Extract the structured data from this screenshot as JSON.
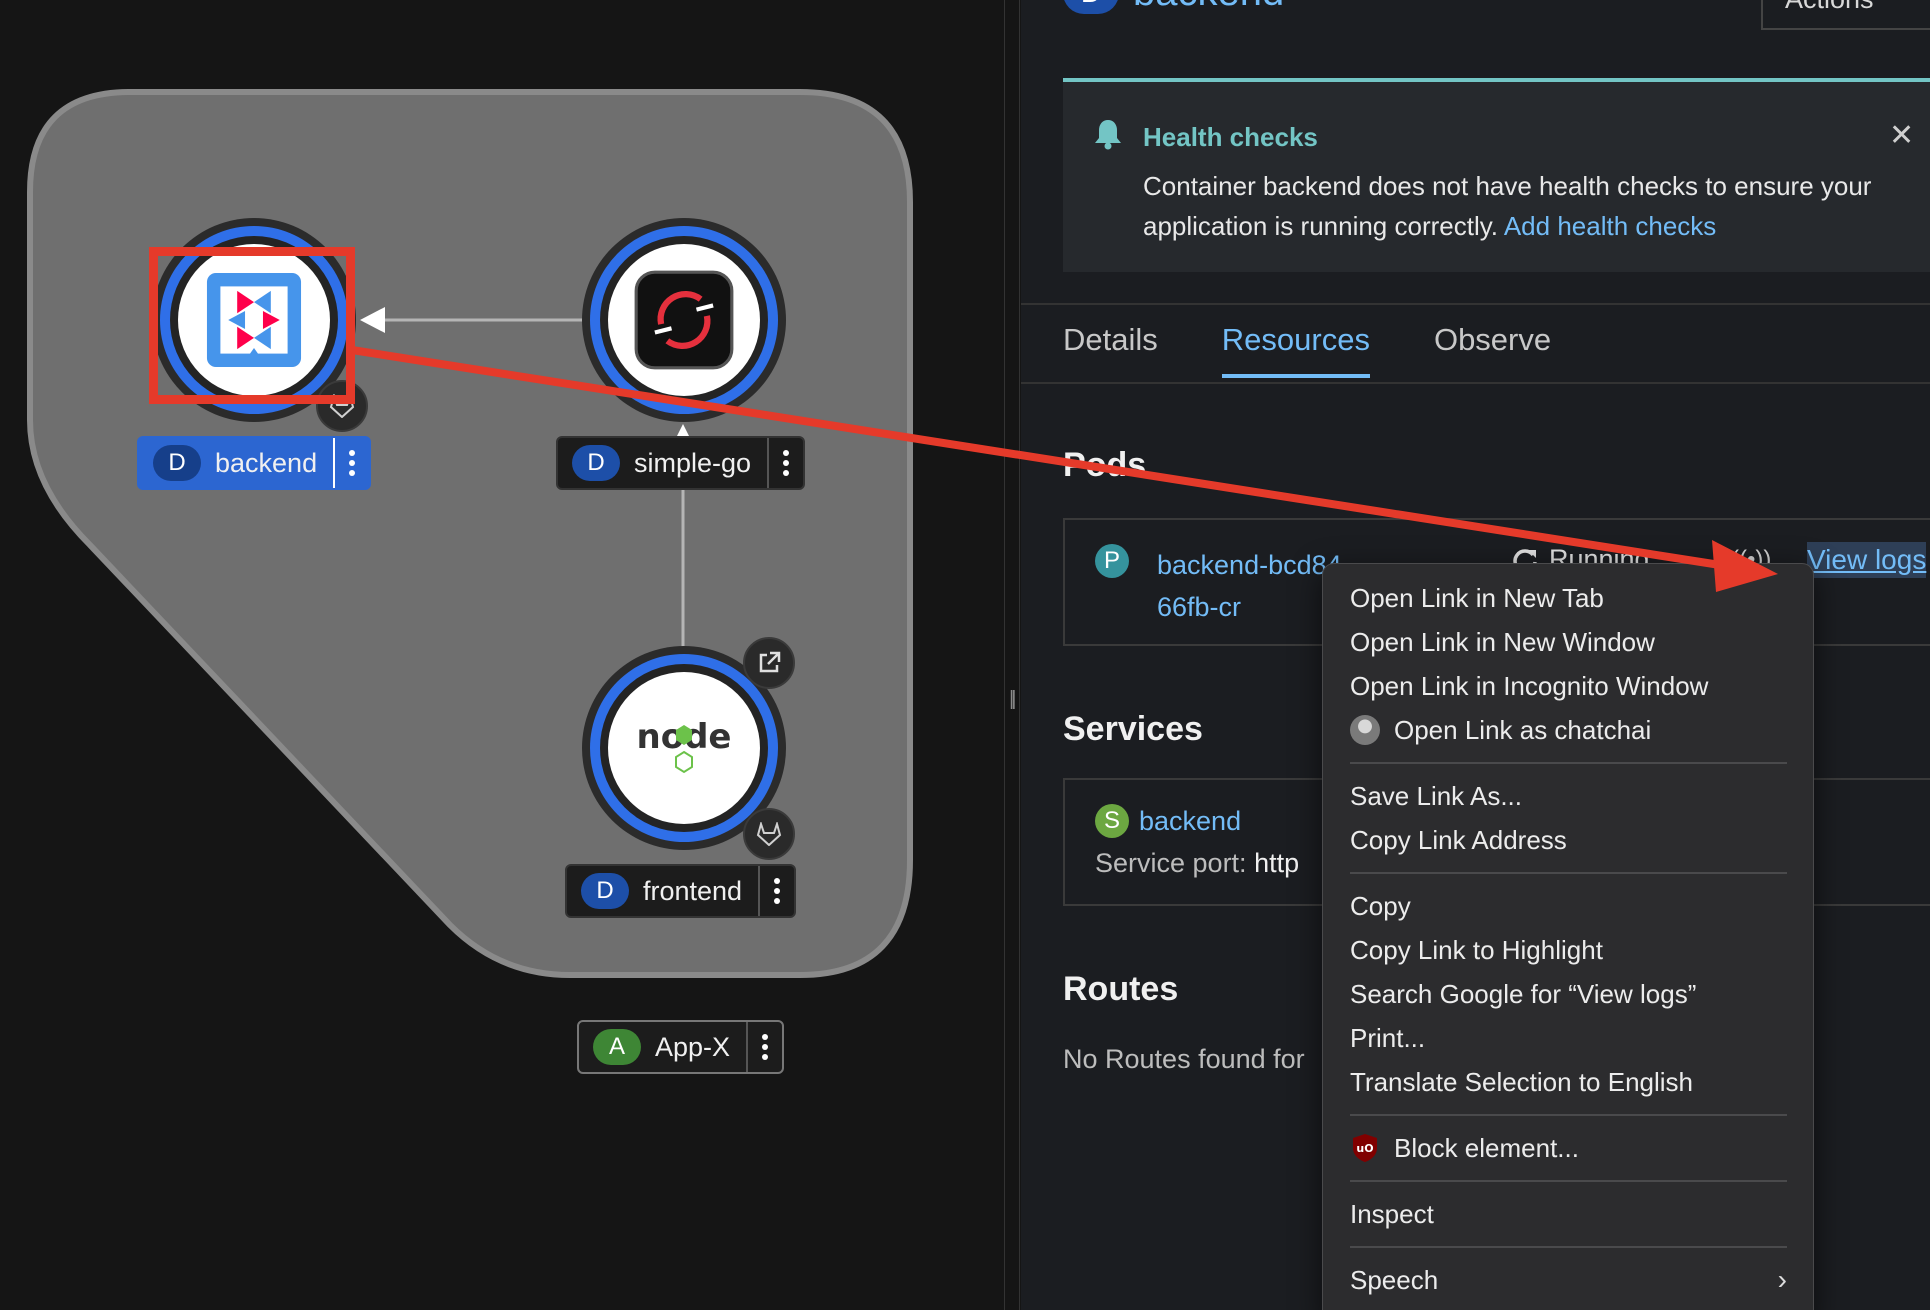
{
  "topology": {
    "nodes": [
      {
        "kind": "D",
        "name": "backend",
        "icon": "quarkus-icon",
        "selected": true
      },
      {
        "kind": "D",
        "name": "simple-go",
        "icon": "openshift-icon",
        "selected": false
      },
      {
        "kind": "D",
        "name": "frontend",
        "icon": "nodejs-icon",
        "selected": false
      }
    ],
    "application": {
      "kind": "A",
      "name": "App-X"
    },
    "nodejs_logo_text": "node"
  },
  "panel": {
    "resource_kind": "D",
    "resource_name": "backend",
    "actions_label": "Actions",
    "alert": {
      "title": "Health checks",
      "body": "Container backend does not have health checks to ensure your application is running correctly.",
      "link": "Add health checks"
    },
    "tabs": [
      {
        "label": "Details",
        "active": false
      },
      {
        "label": "Resources",
        "active": true
      },
      {
        "label": "Observe",
        "active": false
      }
    ],
    "pods": {
      "title": "Pods",
      "badge": "P",
      "name": "backend-bcd8466fb-cr",
      "status": "Running",
      "link": "View logs"
    },
    "services": {
      "title": "Services",
      "badge": "S",
      "name": "backend",
      "port_label": "Service port:",
      "port_value": "http"
    },
    "routes": {
      "title": "Routes",
      "empty": "No Routes found for"
    }
  },
  "context_menu": {
    "groups": [
      [
        "Open Link in New Tab",
        "Open Link in New Window",
        "Open Link in Incognito Window",
        "Open Link as chatchai"
      ],
      [
        "Save Link As...",
        "Copy Link Address"
      ],
      [
        "Copy",
        "Copy Link to Highlight",
        "Search Google for “View logs”",
        "Print...",
        "Translate Selection to English"
      ],
      [
        "Block element..."
      ],
      [
        "Inspect"
      ],
      [
        "Speech"
      ]
    ]
  },
  "colors": {
    "accent_blue": "#73bcf7",
    "selection_red": "#e53a2a",
    "alert_teal": "#73c5c5",
    "node_ring_blue": "#2f6fe8"
  }
}
